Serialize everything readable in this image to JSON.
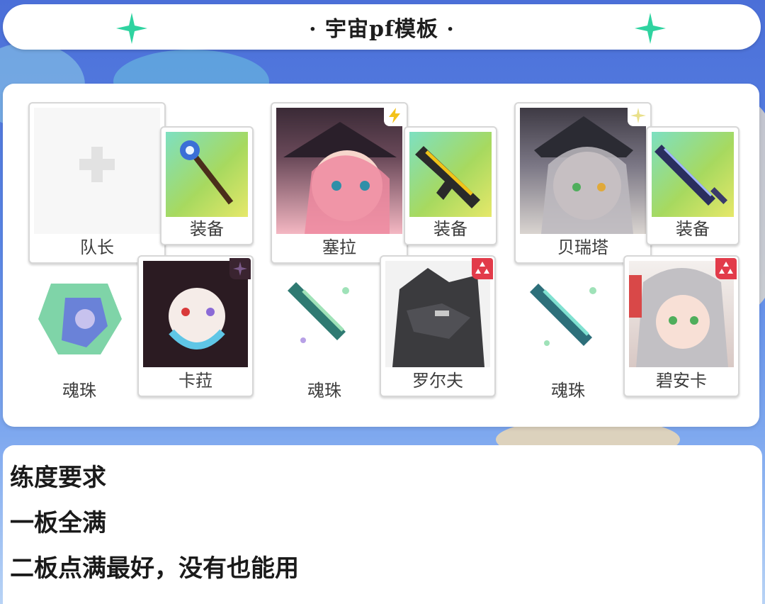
{
  "title": "· 宇宙pf模板 ·",
  "team": {
    "leader": {
      "label": "队长"
    },
    "characters": [
      {
        "name": "塞拉",
        "badge": "lightning"
      },
      {
        "name": "贝瑞塔",
        "badge": "sparkle"
      }
    ],
    "equipment_label": "装备",
    "units": [
      {
        "name": "卡菈",
        "badge": "dark-sparkle"
      },
      {
        "name": "罗尔夫",
        "badge": "red-triangles"
      },
      {
        "name": "碧安卡",
        "badge": "red-triangles"
      }
    ],
    "soul_label": "魂珠"
  },
  "requirements": {
    "heading": "练度要求",
    "lines": [
      "一板全满",
      "二板点满最好，没有也能用"
    ]
  },
  "colors": {
    "sparkle": "#2fd3a0",
    "badge_red": "#e23b4a",
    "badge_yellow": "#f3c21a"
  }
}
